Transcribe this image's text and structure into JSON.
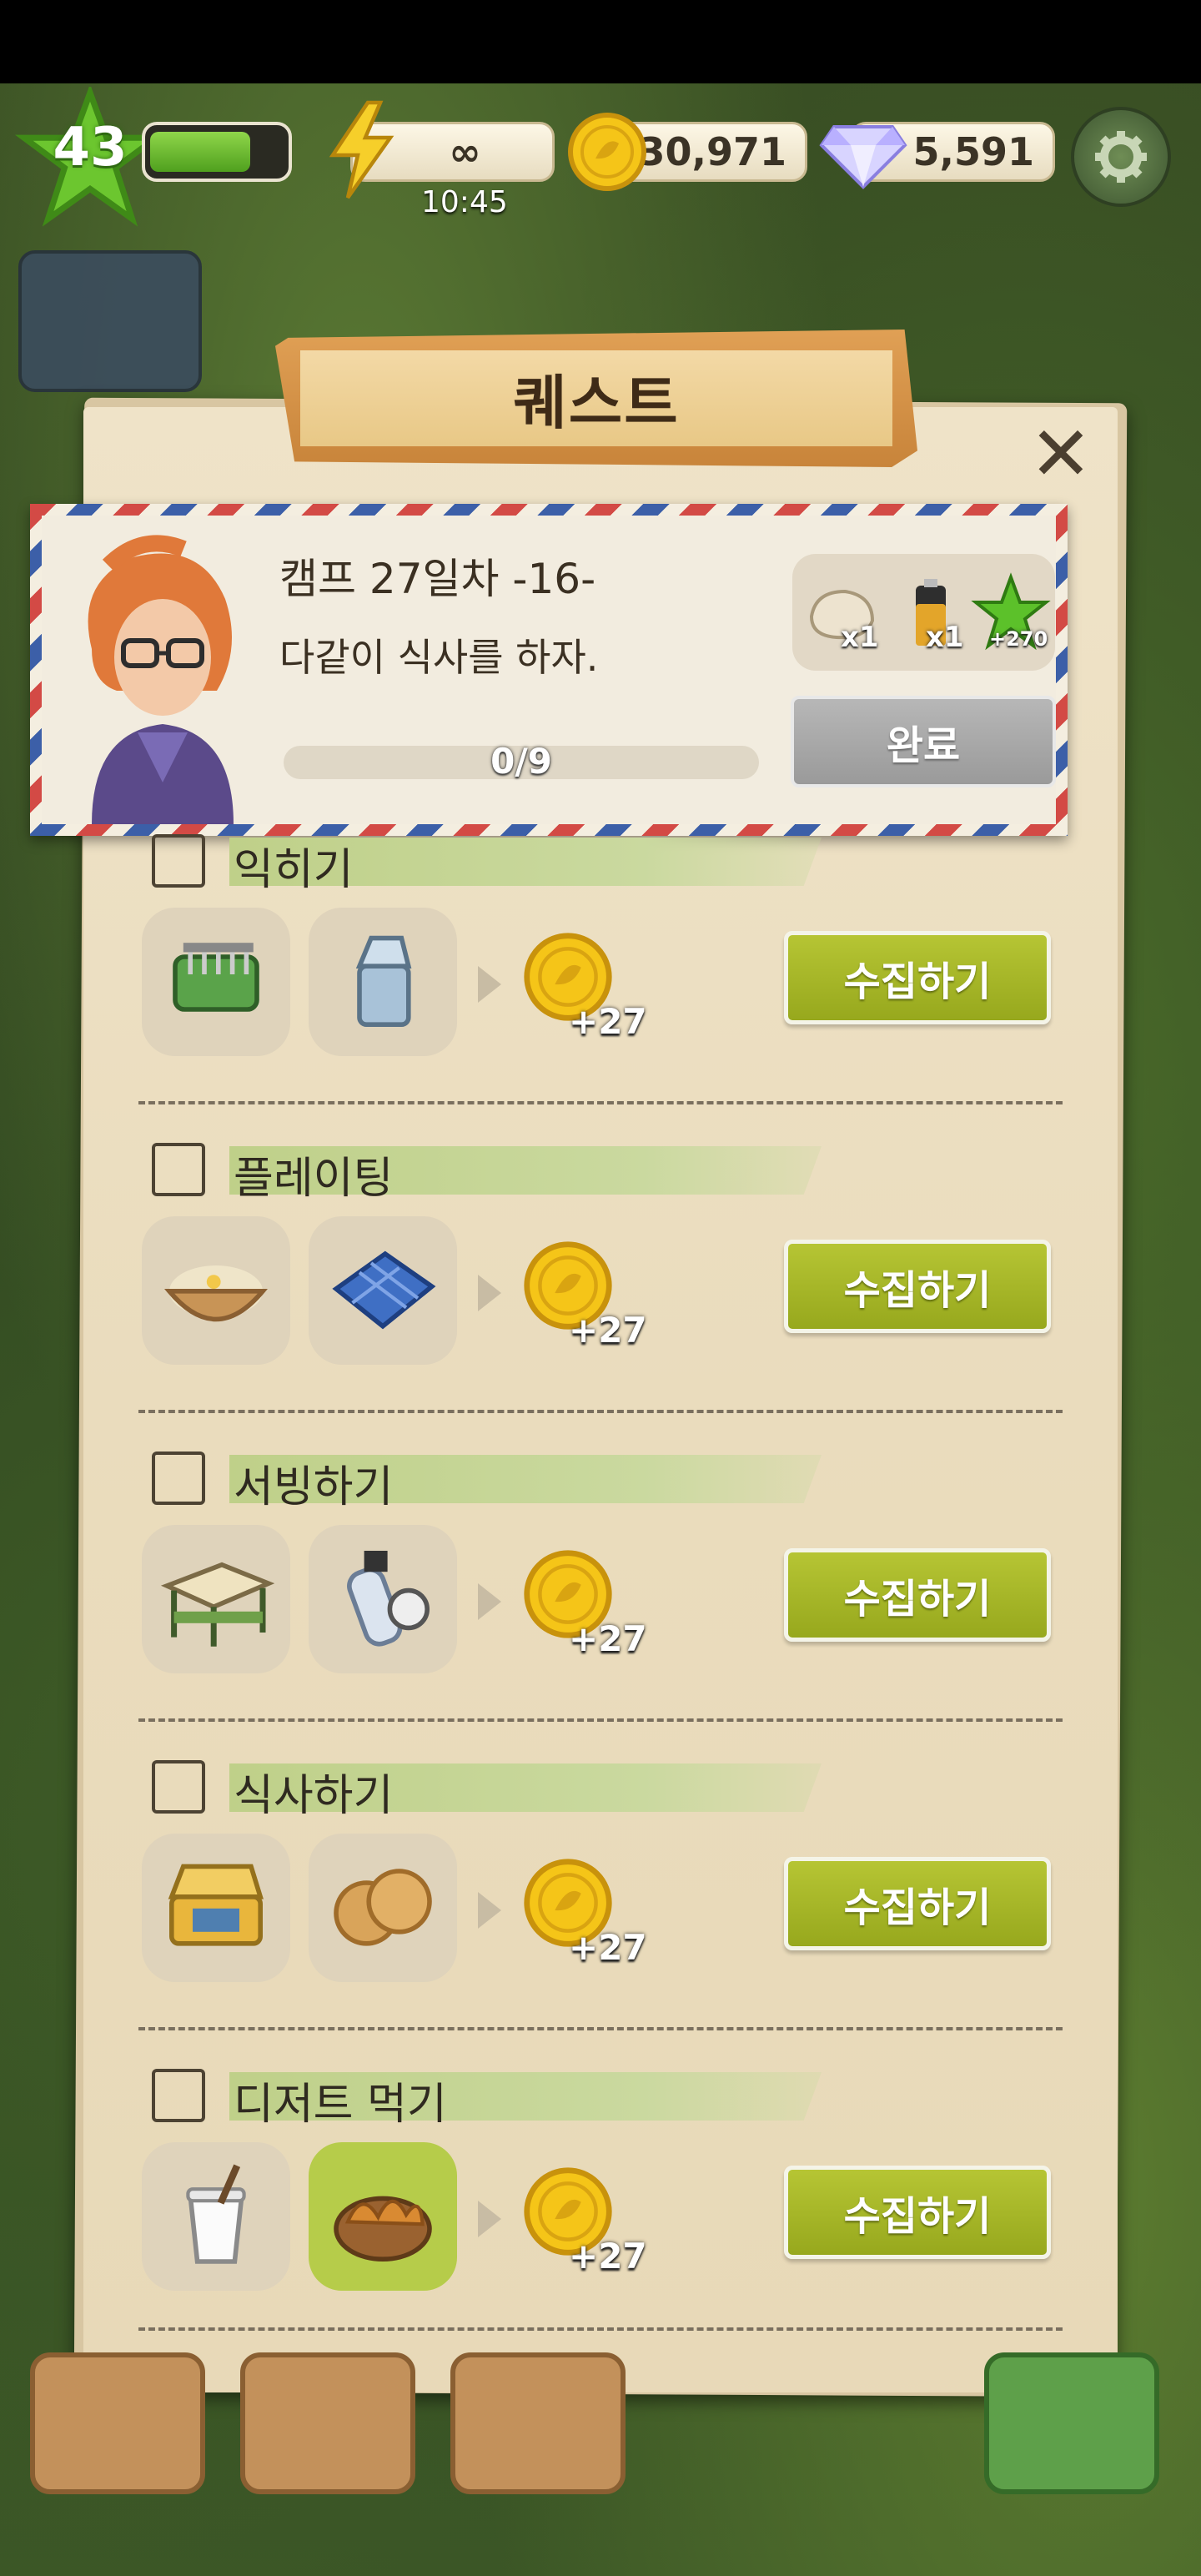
{
  "hud": {
    "level": "43",
    "xp_progress": 0.75,
    "energy": "∞",
    "energy_timer": "10:45",
    "coins": "30,971",
    "gems": "5,591"
  },
  "panel": {
    "title": "퀘스트"
  },
  "quest": {
    "title": "캠프 27일차 -16-",
    "description": "다같이 식사를 하자.",
    "progress_text": "0/9",
    "progress": 0,
    "rewards": [
      {
        "icon": "cloth-bag-icon",
        "qty": "x1"
      },
      {
        "icon": "battery-icon",
        "qty": "x1"
      },
      {
        "icon": "xp-star-icon",
        "qty": "+270"
      }
    ],
    "complete_label": "완료"
  },
  "tasks": [
    {
      "label": "익히기",
      "items": [
        "grill-icon",
        "lighter-icon"
      ],
      "coins": "+27",
      "button": "수집하기"
    },
    {
      "label": "플레이팅",
      "items": [
        "bowl-dish-icon",
        "cloth-napkin-icon"
      ],
      "coins": "+27",
      "button": "수집하기"
    },
    {
      "label": "서빙하기",
      "items": [
        "camp-table-icon",
        "gas-canister-icon"
      ],
      "coins": "+27",
      "button": "수집하기"
    },
    {
      "label": "식사하기",
      "items": [
        "lunchbox-icon",
        "crackers-icon"
      ],
      "coins": "+27",
      "button": "수집하기"
    },
    {
      "label": "디저트 먹기",
      "items": [
        "yogurt-icon",
        "fried-potato-icon"
      ],
      "coins": "+27",
      "button": "수집하기"
    }
  ],
  "colors": {
    "collect_green": "#a8b82a",
    "complete_gray": "#a8a8a8",
    "panel_paper": "#ece0c3"
  }
}
